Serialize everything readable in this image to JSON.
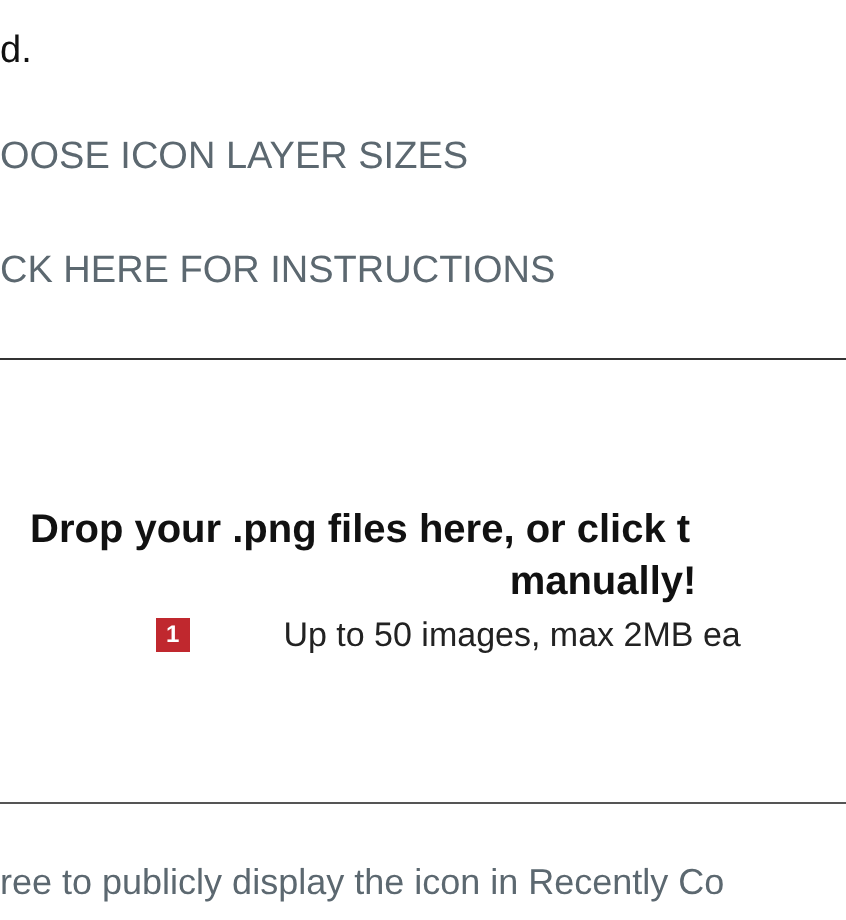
{
  "intro_tail": "d.",
  "links": [
    "OOSE ICON LAYER SIZES",
    "CK HERE FOR INSTRUCTIONS"
  ],
  "dropzone": {
    "title": "Drop your .png files here, or click t",
    "title_line_2": "manually!",
    "badge": "1",
    "note": "Up to 50 images, max 2MB ea"
  },
  "consent": {
    "label": "ree to publicly display the icon in Recently Co"
  }
}
